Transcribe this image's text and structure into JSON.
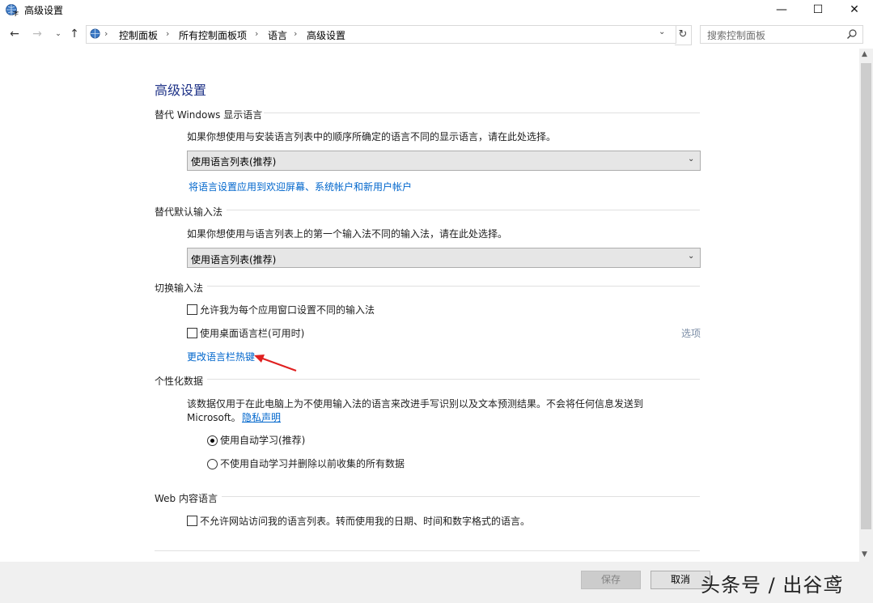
{
  "window": {
    "title": "高级设置",
    "minimize_glyph": "—",
    "maximize_glyph": "☐",
    "close_glyph": "✕"
  },
  "address_bar": {
    "breadcrumbs": [
      "控制面板",
      "所有控制面板项",
      "语言",
      "高级设置"
    ],
    "separator": "›",
    "search_placeholder": "搜索控制面板"
  },
  "content": {
    "page_title": "高级设置",
    "display_language": {
      "heading": "替代 Windows 显示语言",
      "description": "如果你想使用与安装语言列表中的顺序所确定的语言不同的显示语言，请在此处选择。",
      "selected": "使用语言列表(推荐)",
      "apply_link": "将语言设置应用到欢迎屏幕、系统帐户和新用户帐户"
    },
    "default_input": {
      "heading": "替代默认输入法",
      "description": "如果你想使用与语言列表上的第一个输入法不同的输入法，请在此处选择。",
      "selected": "使用语言列表(推荐)"
    },
    "switch_input": {
      "heading": "切换输入法",
      "option_per_app": "允许我为每个应用窗口设置不同的输入法",
      "option_per_app_checked": false,
      "option_langbar": "使用桌面语言栏(可用时)",
      "option_langbar_checked": false,
      "options_link": "选项",
      "hotkeys_link": "更改语言栏热键"
    },
    "personalization": {
      "heading": "个性化数据",
      "description_line1": "该数据仅用于在此电脑上为不使用输入法的语言来改进手写识别以及文本预测结果。不会将任何信息发送到",
      "description_line2": "Microsoft。",
      "privacy_link": "隐私声明",
      "radio_auto": "使用自动学习(推荐)",
      "radio_auto_selected": true,
      "radio_no_auto": "不使用自动学习并删除以前收集的所有数据",
      "radio_no_auto_selected": false
    },
    "web_content": {
      "heading": "Web 内容语言",
      "option": "不允许网站访问我的语言列表。转而使用我的日期、时间和数字格式的语言。",
      "option_checked": false
    }
  },
  "footer": {
    "save_label": "保存",
    "cancel_label": "取消"
  },
  "watermark": "头条号 / 出谷鸢",
  "colors": {
    "title_blue": "#1e3287",
    "link_blue": "#0066cc",
    "annotation_red": "#e02020"
  }
}
